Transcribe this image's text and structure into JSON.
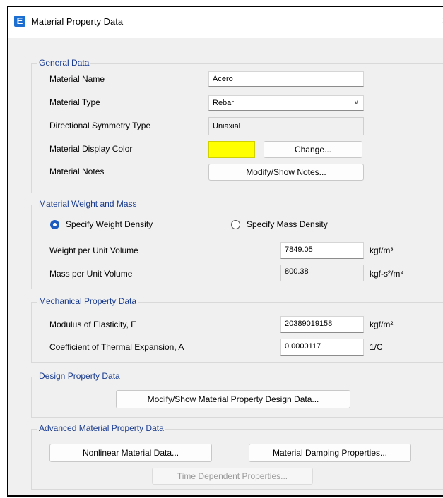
{
  "window": {
    "title": "Material Property Data",
    "icon_letter": "E",
    "close_glyph": "×"
  },
  "general": {
    "title": "General Data",
    "material_name_label": "Material Name",
    "material_name_value": "Acero",
    "material_type_label": "Material Type",
    "material_type_value": "Rebar",
    "symmetry_label": "Directional Symmetry Type",
    "symmetry_value": "Uniaxial",
    "display_color_label": "Material Display Color",
    "display_color": "#ffff00",
    "change_button": "Change...",
    "notes_label": "Material Notes",
    "notes_button": "Modify/Show Notes..."
  },
  "weight_mass": {
    "title": "Material Weight and Mass",
    "radio_weight": "Specify Weight Density",
    "radio_mass": "Specify Mass Density",
    "selected": "Specify Weight Density",
    "weight_label": "Weight per Unit Volume",
    "weight_value": "7849.05",
    "weight_unit": "kgf/m³",
    "mass_label": "Mass per Unit Volume",
    "mass_value": "800.38",
    "mass_unit": "kgf-s²/m⁴"
  },
  "mechanical": {
    "title": "Mechanical Property Data",
    "modulus_label": "Modulus of Elasticity,  E",
    "modulus_value": "20389019158",
    "modulus_unit": "kgf/m²",
    "thermal_label": "Coefficient of Thermal Expansion,  A",
    "thermal_value": "0.0000117",
    "thermal_unit": "1/C"
  },
  "design": {
    "title": "Design Property Data",
    "button": "Modify/Show Material Property Design Data..."
  },
  "advanced": {
    "title": "Advanced Material Property Data",
    "nonlinear_button": "Nonlinear Material Data...",
    "damping_button": "Material Damping Properties...",
    "time_button": "Time Dependent Properties..."
  },
  "colors": {
    "accent": "#1d5bbf",
    "group_title": "#1a3c8f",
    "swatch": "#ffff00"
  }
}
